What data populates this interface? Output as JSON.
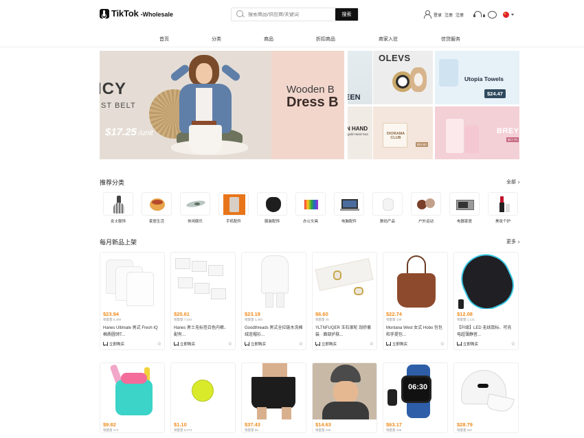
{
  "header": {
    "logo_text": "TikTok",
    "logo_sub": "-Wholesale",
    "search_placeholder": "搜索商品/供应商/关键词",
    "search_button": "搜索",
    "login": "登录",
    "register": "注册",
    "signup": "注册"
  },
  "nav": {
    "items": [
      "首页",
      "分类",
      "商品",
      "折扣商品",
      "商家入驻",
      "信贷服务"
    ]
  },
  "banner": {
    "main_left_line1": "ICY",
    "main_left_line2": "IST BELT",
    "main_left_price": "$17.25",
    "main_left_unit": " /unit",
    "main_right_line1": "Wooden B",
    "main_right_line2": "Dress B",
    "tile1_text": "EEN",
    "tile2_text": "OLEVS",
    "tile3_text": "Utopia Towels",
    "tile3_price": "$24.47",
    "tile4_text": "N HAND",
    "tile4_sub": "gold Hand Soa",
    "tile5_text": "DIORAMA CLUB",
    "tile5_price": "$19.60",
    "tile6_text": "BREYLEE",
    "tile6_price": "$17.70"
  },
  "categories": {
    "title": "推荐分类",
    "more": "全部",
    "items": [
      "女士服饰",
      "家居生活",
      "休闲娱乐",
      "手机配件",
      "服装配饰",
      "办公文具",
      "电脑配件",
      "数码产品",
      "户外运动",
      "电器家居",
      "美妆个护"
    ]
  },
  "products": {
    "title": "每月新品上架",
    "more": "更多",
    "buy_label": "立即购买",
    "items": [
      {
        "price": "$23.94",
        "sold": "销量量 6,498",
        "name": "Hanes Ultimate 男式 Fresh IQ 棉质圆领T..."
      },
      {
        "price": "$20.61",
        "sold": "销量量 7,033",
        "name": "Hanes 男士无标签白色内裤、 配有..."
      },
      {
        "price": "$23.19",
        "sold": "销量量 1,483",
        "name": "Goodthreads 男式全拉链水洗棉绒连帽衫..."
      },
      {
        "price": "$6.60",
        "sold": "销量量 45",
        "name": "YLTNFUQER 玉石滚轮 刮痧套装 · 面部护肤..."
      },
      {
        "price": "$22.74",
        "sold": "销量量 139",
        "name": "Montana West 女式 Hobo 包包和手提包..."
      },
      {
        "price": "$12.08",
        "sold": "销量量 1,131",
        "name": "【升级】LED 无线鼠标、可充电超薄静音..."
      },
      {
        "price": "$9.82",
        "sold": "销量量 273",
        "name": ""
      },
      {
        "price": "$1.10",
        "sold": "销量量 8,073",
        "name": ""
      },
      {
        "price": "$37.43",
        "sold": "销量量 88",
        "name": ""
      },
      {
        "price": "$14.63",
        "sold": "销量量 238",
        "name": ""
      },
      {
        "price": "$63.17",
        "sold": "销量量 436",
        "name": ""
      },
      {
        "price": "$28.79",
        "sold": "销量量 287",
        "name": ""
      }
    ]
  },
  "colors": {
    "accent_price": "#f08a1a",
    "primary_button": "#111111"
  }
}
